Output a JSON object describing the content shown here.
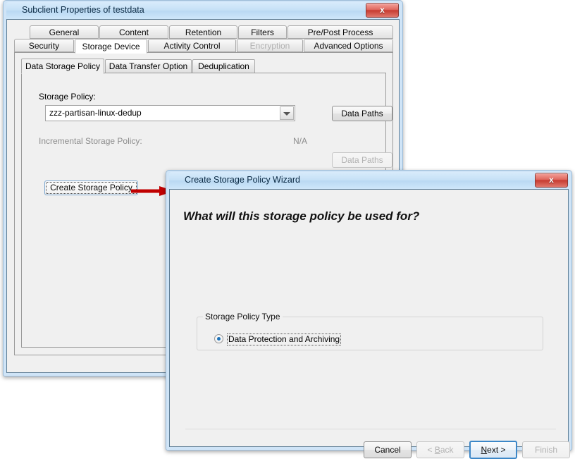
{
  "background": {
    "color": "#ffffff"
  },
  "subclient_window": {
    "title": "Subclient Properties of testdata",
    "close_label": "x",
    "tabs_row1": [
      {
        "label": "General",
        "state": "normal"
      },
      {
        "label": "Content",
        "state": "normal"
      },
      {
        "label": "Retention",
        "state": "normal"
      },
      {
        "label": "Filters",
        "state": "normal"
      },
      {
        "label": "Pre/Post Process",
        "state": "normal"
      }
    ],
    "tabs_row2": [
      {
        "label": "Security",
        "state": "normal"
      },
      {
        "label": "Storage Device",
        "state": "active"
      },
      {
        "label": "Activity Control",
        "state": "normal"
      },
      {
        "label": "Encryption",
        "state": "disabled"
      },
      {
        "label": "Advanced Options",
        "state": "normal"
      }
    ],
    "inner_tabs": [
      {
        "label": "Data Storage Policy",
        "state": "active"
      },
      {
        "label": "Data Transfer Option",
        "state": "normal"
      },
      {
        "label": "Deduplication",
        "state": "normal"
      }
    ],
    "storage_policy_label": "Storage Policy:",
    "storage_policy_value": "zzz-partisan-linux-dedup",
    "data_paths_button": "Data Paths",
    "incremental_label": "Incremental Storage Policy:",
    "incremental_value": "N/A",
    "incremental_data_paths_button": "Data Paths",
    "create_storage_policy_button": "Create Storage Policy",
    "arrow": {
      "name": "red-arrow",
      "color": "#c00000"
    }
  },
  "wizard_window": {
    "title": "Create Storage Policy Wizard",
    "close_label": "x",
    "heading": "What will this storage policy be used for?",
    "group": {
      "title": "Storage Policy Type",
      "options": [
        {
          "label": "Data Protection and Archiving",
          "selected": true,
          "focused": true
        }
      ]
    },
    "buttons": {
      "cancel": "Cancel",
      "back_prefix": "< ",
      "back_accel": "B",
      "back_suffix": "ack",
      "next_accel": "N",
      "next_suffix": "ext >",
      "finish": "Finish"
    }
  }
}
